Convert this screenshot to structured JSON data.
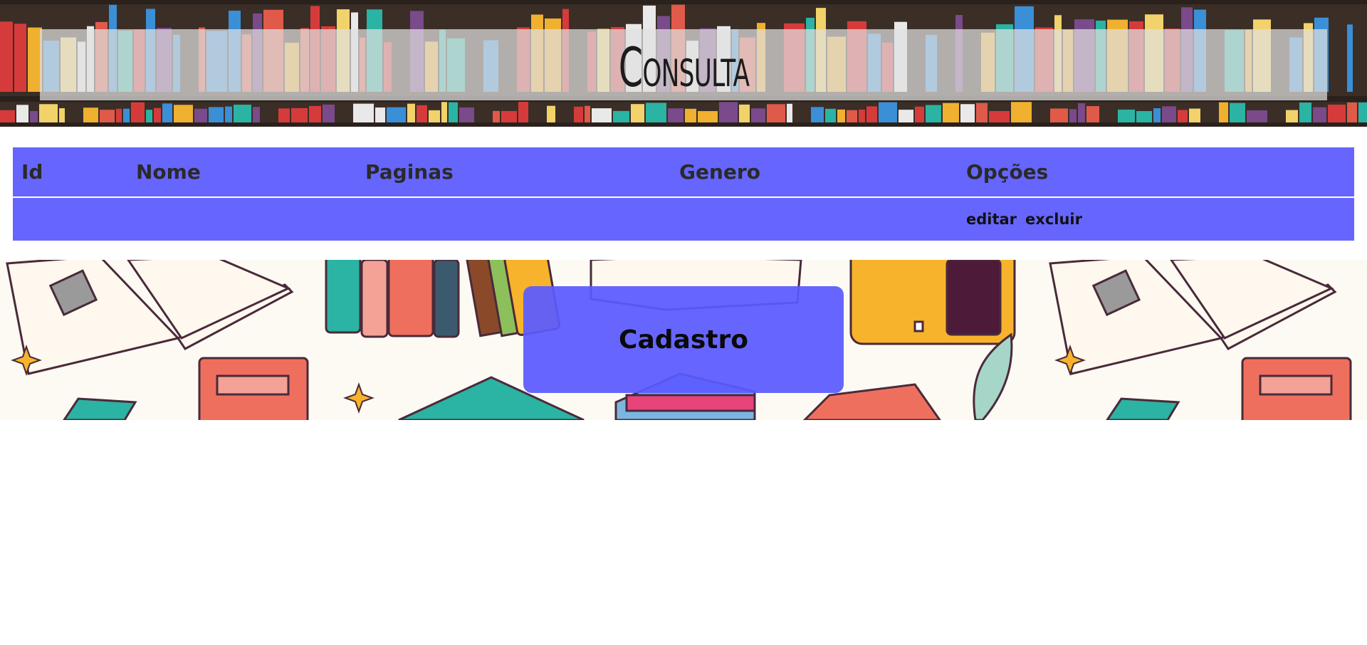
{
  "header": {
    "title": "Consulta"
  },
  "table": {
    "columns": [
      "Id",
      "Nome",
      "Paginas",
      "Genero",
      "Opções"
    ],
    "rows": [
      {
        "id": "",
        "nome": "",
        "paginas": "",
        "genero": "",
        "edit_label": "editar",
        "delete_label": "excluir"
      }
    ]
  },
  "cadastro": {
    "label": "Cadastro"
  },
  "colors": {
    "table_bg": "#6666ff",
    "button_bg": "#5a5aff",
    "banner_bg": "#3a2e27"
  }
}
